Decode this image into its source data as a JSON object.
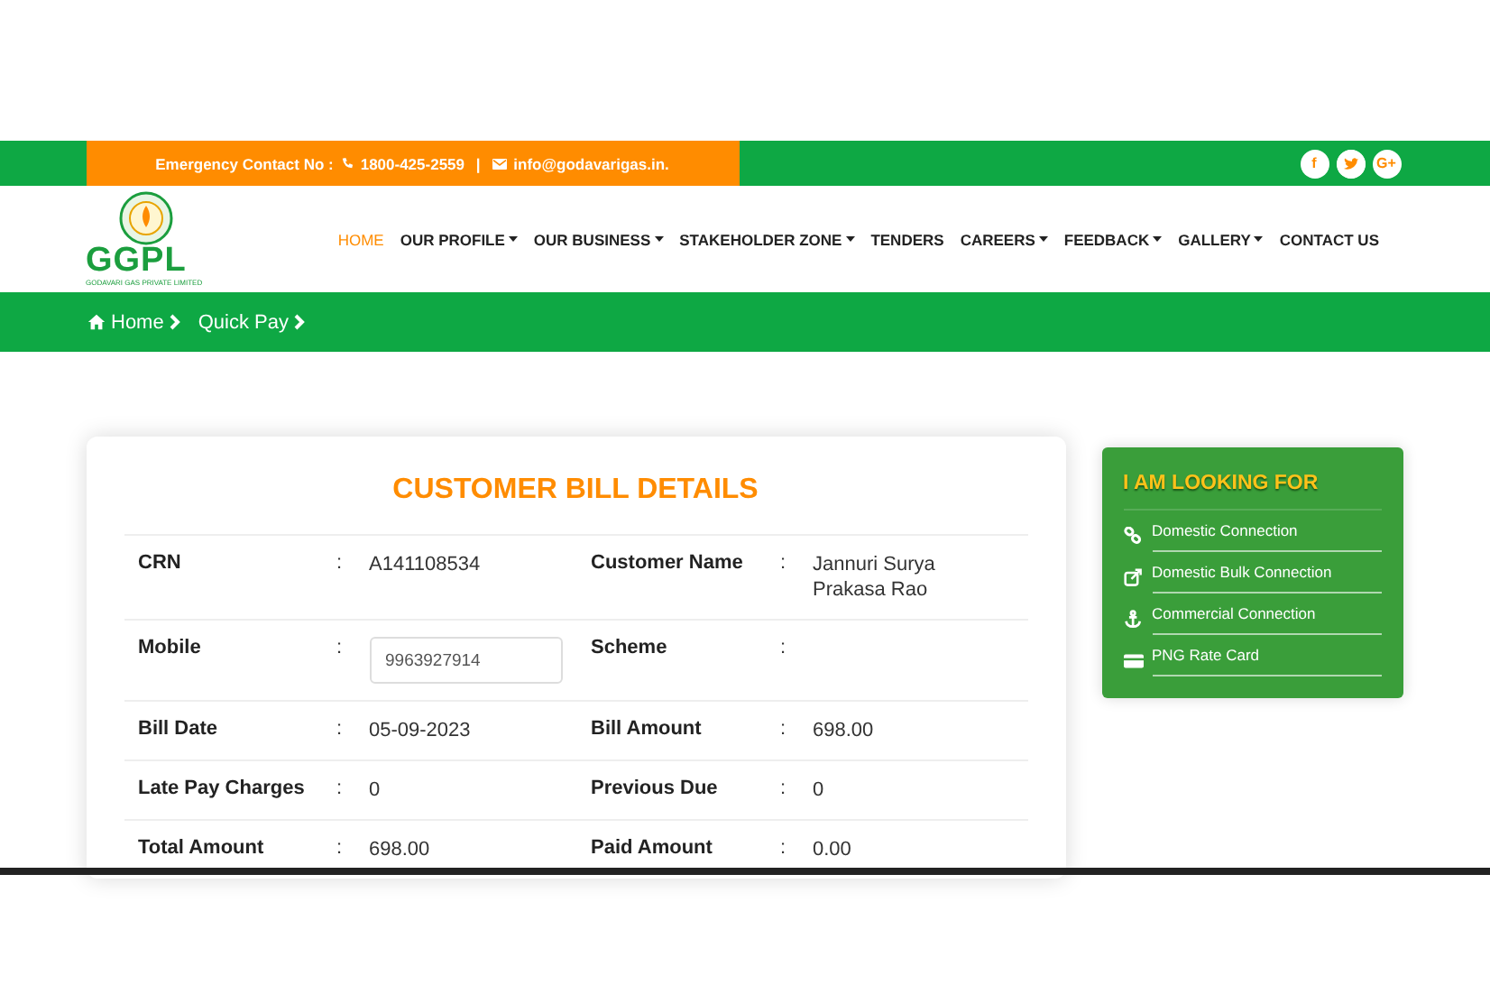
{
  "top_bar": {
    "emergency_label": "Emergency Contact No :",
    "phone": "1800-425-2559",
    "separator": "|",
    "email": "info@godavarigas.in.",
    "social": [
      {
        "kind": "facebook",
        "glyph": "f"
      },
      {
        "kind": "twitter"
      },
      {
        "kind": "google",
        "glyph": "G+"
      }
    ]
  },
  "logo": {
    "text": "GGPL",
    "tagline": "GODAVARI GAS PRIVATE LIMITED"
  },
  "nav": [
    {
      "label": "HOME",
      "selected": true,
      "dropdown": false
    },
    {
      "label": "OUR PROFILE",
      "selected": false,
      "dropdown": true
    },
    {
      "label": "OUR BUSINESS",
      "selected": false,
      "dropdown": true
    },
    {
      "label": "STAKEHOLDER ZONE",
      "selected": false,
      "dropdown": true
    },
    {
      "label": "TENDERS",
      "selected": false,
      "dropdown": false
    },
    {
      "label": "CAREERS",
      "selected": false,
      "dropdown": true
    },
    {
      "label": "FEEDBACK",
      "selected": false,
      "dropdown": true
    },
    {
      "label": "GALLERY",
      "selected": false,
      "dropdown": true
    },
    {
      "label": "CONTACT US",
      "selected": false,
      "dropdown": false
    }
  ],
  "breadcrumb": [
    {
      "label": "Home"
    },
    {
      "label": "Quick Pay"
    }
  ],
  "bill": {
    "title": "CUSTOMER BILL DETAILS",
    "rows": [
      [
        {
          "label": "CRN",
          "colon": ":",
          "value": "A141108534"
        },
        {
          "label": "Customer Name",
          "colon": ":",
          "value": "Jannuri Surya Prakasa Rao"
        }
      ],
      [
        {
          "label": "Mobile",
          "colon": ":",
          "kind": "input",
          "value": "9963927914"
        },
        {
          "label": "Scheme",
          "colon": ":"
        }
      ],
      [
        {
          "label": "Bill Date",
          "colon": ":",
          "value": "05-09-2023"
        },
        {
          "label": "Bill Amount",
          "colon": ":",
          "value": "698.00"
        }
      ],
      [
        {
          "label": "Late Pay Charges",
          "colon": ":",
          "value": "0"
        },
        {
          "label": "Previous Due",
          "colon": ":",
          "value": "0"
        }
      ],
      [
        {
          "label": "Total Amount",
          "colon": ":",
          "value": "698.00"
        },
        {
          "label": "Paid Amount",
          "colon": ":",
          "value": "0.00"
        }
      ]
    ]
  },
  "sidebar": {
    "title": "I AM LOOKING FOR",
    "items": [
      {
        "label": "Domestic Connection"
      },
      {
        "label": "Domestic Bulk Connection"
      },
      {
        "label": "Commercial Connection"
      },
      {
        "label": "PNG Rate Card"
      }
    ]
  }
}
